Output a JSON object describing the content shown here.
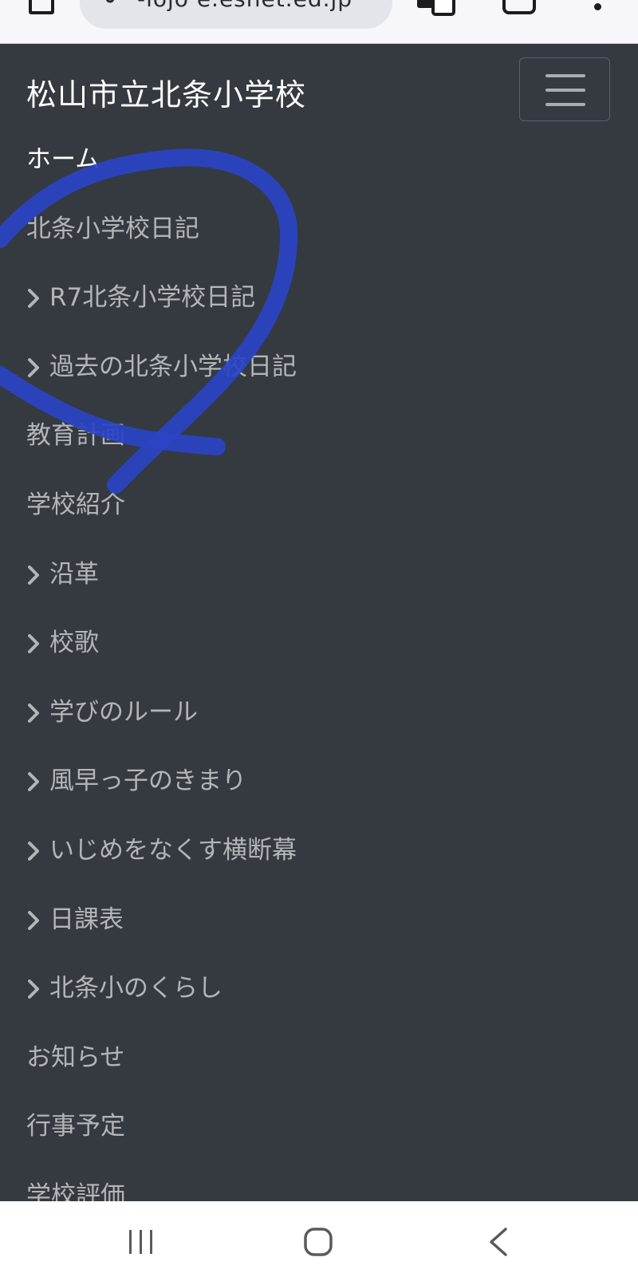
{
  "browser": {
    "url": "-lojo e.esnet.ed.jp"
  },
  "site": {
    "title": "松山市立北条小学校"
  },
  "nav": {
    "items": [
      {
        "label": "ホーム",
        "chevron": false,
        "active": true
      },
      {
        "label": "北条小学校日記",
        "chevron": false,
        "active": false
      },
      {
        "label": "R7北条小学校日記",
        "chevron": true,
        "active": false
      },
      {
        "label": "過去の北条小学校日記",
        "chevron": true,
        "active": false
      },
      {
        "label": "教育計画",
        "chevron": false,
        "active": false
      },
      {
        "label": "学校紹介",
        "chevron": false,
        "active": false
      },
      {
        "label": "沿革",
        "chevron": true,
        "active": false
      },
      {
        "label": "校歌",
        "chevron": true,
        "active": false
      },
      {
        "label": "学びのルール",
        "chevron": true,
        "active": false
      },
      {
        "label": "風早っ子のきまり",
        "chevron": true,
        "active": false
      },
      {
        "label": "いじめをなくす横断幕",
        "chevron": true,
        "active": false
      },
      {
        "label": "日課表",
        "chevron": true,
        "active": false
      },
      {
        "label": "北条小のくらし",
        "chevron": true,
        "active": false
      },
      {
        "label": "お知らせ",
        "chevron": false,
        "active": false
      },
      {
        "label": "行事予定",
        "chevron": false,
        "active": false
      },
      {
        "label": "学校評価",
        "chevron": false,
        "active": false
      }
    ]
  },
  "colors": {
    "navbar_bg": "#343a40",
    "link": "#b3b5b8",
    "link_active": "#ffffff",
    "annotation": "#2a44c4"
  },
  "icons": {
    "chevron": "chevron-right-icon",
    "toggler": "hamburger-icon",
    "system_nav": [
      "recent-apps-icon",
      "home-icon",
      "back-icon"
    ]
  }
}
